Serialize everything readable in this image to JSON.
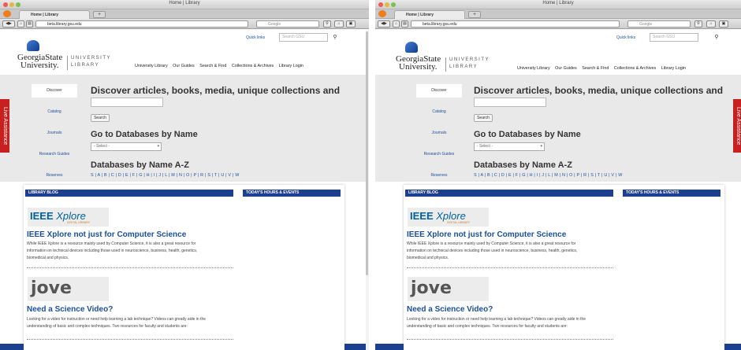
{
  "window": {
    "title": "Home | Library",
    "tab_label": "Home | Library",
    "new_tab": "+",
    "url": "beta.library.gsu.edu",
    "search_engine": "Google"
  },
  "header": {
    "quick_links": "Quick links",
    "search_placeholder": "Search GSU",
    "logo_line1": "GeorgiaState",
    "logo_line2": "University.",
    "logo_unit1": "UNIVERSITY",
    "logo_unit2": "LIBRARY",
    "nav": [
      "University Library",
      "Our Guides",
      "Search & Find",
      "Collections & Archives",
      "Library Login"
    ]
  },
  "sidebar": {
    "items": [
      "Discover",
      "Catalog",
      "Journals",
      "Research Guides",
      "Reserves"
    ]
  },
  "discover": {
    "heading": "Discover articles, books, media, unique collections and more...",
    "search_button": "Search"
  },
  "databases": {
    "heading": "Go to Databases by Name",
    "select_value": "- Select -",
    "az_heading": "Databases by Name A-Z",
    "az_letters": "S | A | B | C | D | E | F | G | H | I | J | L | M | N | O | P | R | S | T | U | V | W"
  },
  "live_assistance": "Live Assistance",
  "blog": {
    "section_label": "LIBRARY BLOG",
    "hours_label": "TODAY'S HOURS & EVENTS",
    "post1": {
      "logo_main": "IEEE",
      "logo_italic": "Xplore",
      "logo_sub": "DIGITAL LIBRARY",
      "title": "IEEE Xplore not just for Computer Science",
      "text_line1": "While IEEE Xplore is a resource mainly used by Computer Science, it is also a great resource for",
      "text_line2": "information on technical devices including those used in neuroscience, business, health, genetics,",
      "text_line3": "biomedical and physics."
    },
    "post2": {
      "logo": "jove",
      "title": "Need a Science Video?",
      "text_line1": "Looking for a video for instruction or need help learning a lab technique? Videos can greatly aide in the",
      "text_line2": "understanding of basic and complex techniques. Two resources for faculty and students are:"
    }
  },
  "colors": {
    "brand_blue": "#1d3f8f",
    "link_blue": "#1b4e9b",
    "live_red": "#c8201f"
  }
}
